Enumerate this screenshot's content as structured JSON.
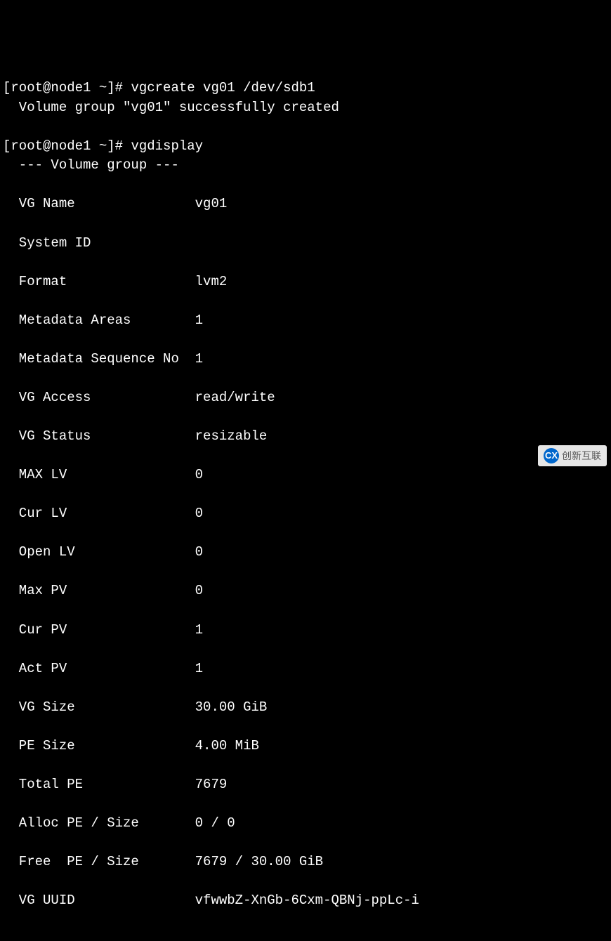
{
  "prompts": {
    "p1": "[root@node1 ~]# ",
    "p2": "[root@node1 ~]# "
  },
  "commands": {
    "c1": "vgcreate vg01 /dev/sdb1",
    "c2": "vgdisplay"
  },
  "output": {
    "created_msg": "  Volume group \"vg01\" successfully created",
    "header": "  --- Volume group ---",
    "rows": {
      "vg_name": {
        "label": "  VG Name               ",
        "value": "vg01"
      },
      "system_id": {
        "label": "  System ID             ",
        "value": ""
      },
      "format": {
        "label": "  Format                ",
        "value": "lvm2"
      },
      "metadata_areas": {
        "label": "  Metadata Areas        ",
        "value": "1"
      },
      "metadata_seq": {
        "label": "  Metadata Sequence No  ",
        "value": "1"
      },
      "vg_access": {
        "label": "  VG Access             ",
        "value": "read/write"
      },
      "vg_status": {
        "label": "  VG Status             ",
        "value": "resizable"
      },
      "max_lv": {
        "label": "  MAX LV                ",
        "value": "0"
      },
      "cur_lv": {
        "label": "  Cur LV                ",
        "value": "0"
      },
      "open_lv": {
        "label": "  Open LV               ",
        "value": "0"
      },
      "max_pv": {
        "label": "  Max PV                ",
        "value": "0"
      },
      "cur_pv": {
        "label": "  Cur PV                ",
        "value": "1"
      },
      "act_pv": {
        "label": "  Act PV                ",
        "value": "1"
      },
      "vg_size": {
        "label": "  VG Size               ",
        "value": "30.00 GiB"
      },
      "pe_size": {
        "label": "  PE Size               ",
        "value": "4.00 MiB"
      },
      "total_pe": {
        "label": "  Total PE              ",
        "value": "7679"
      },
      "alloc_pe": {
        "label": "  Alloc PE / Size       ",
        "value": "0 / 0"
      },
      "free_pe": {
        "label": "  Free  PE / Size       ",
        "value": "7679 / 30.00 GiB"
      },
      "vg_uuid": {
        "label": "  VG UUID               ",
        "value": "vfwwbZ-XnGb-6Cxm-QBNj-ppLc-i"
      }
    }
  },
  "watermark": {
    "icon_text": "CX",
    "text": "创新互联"
  }
}
